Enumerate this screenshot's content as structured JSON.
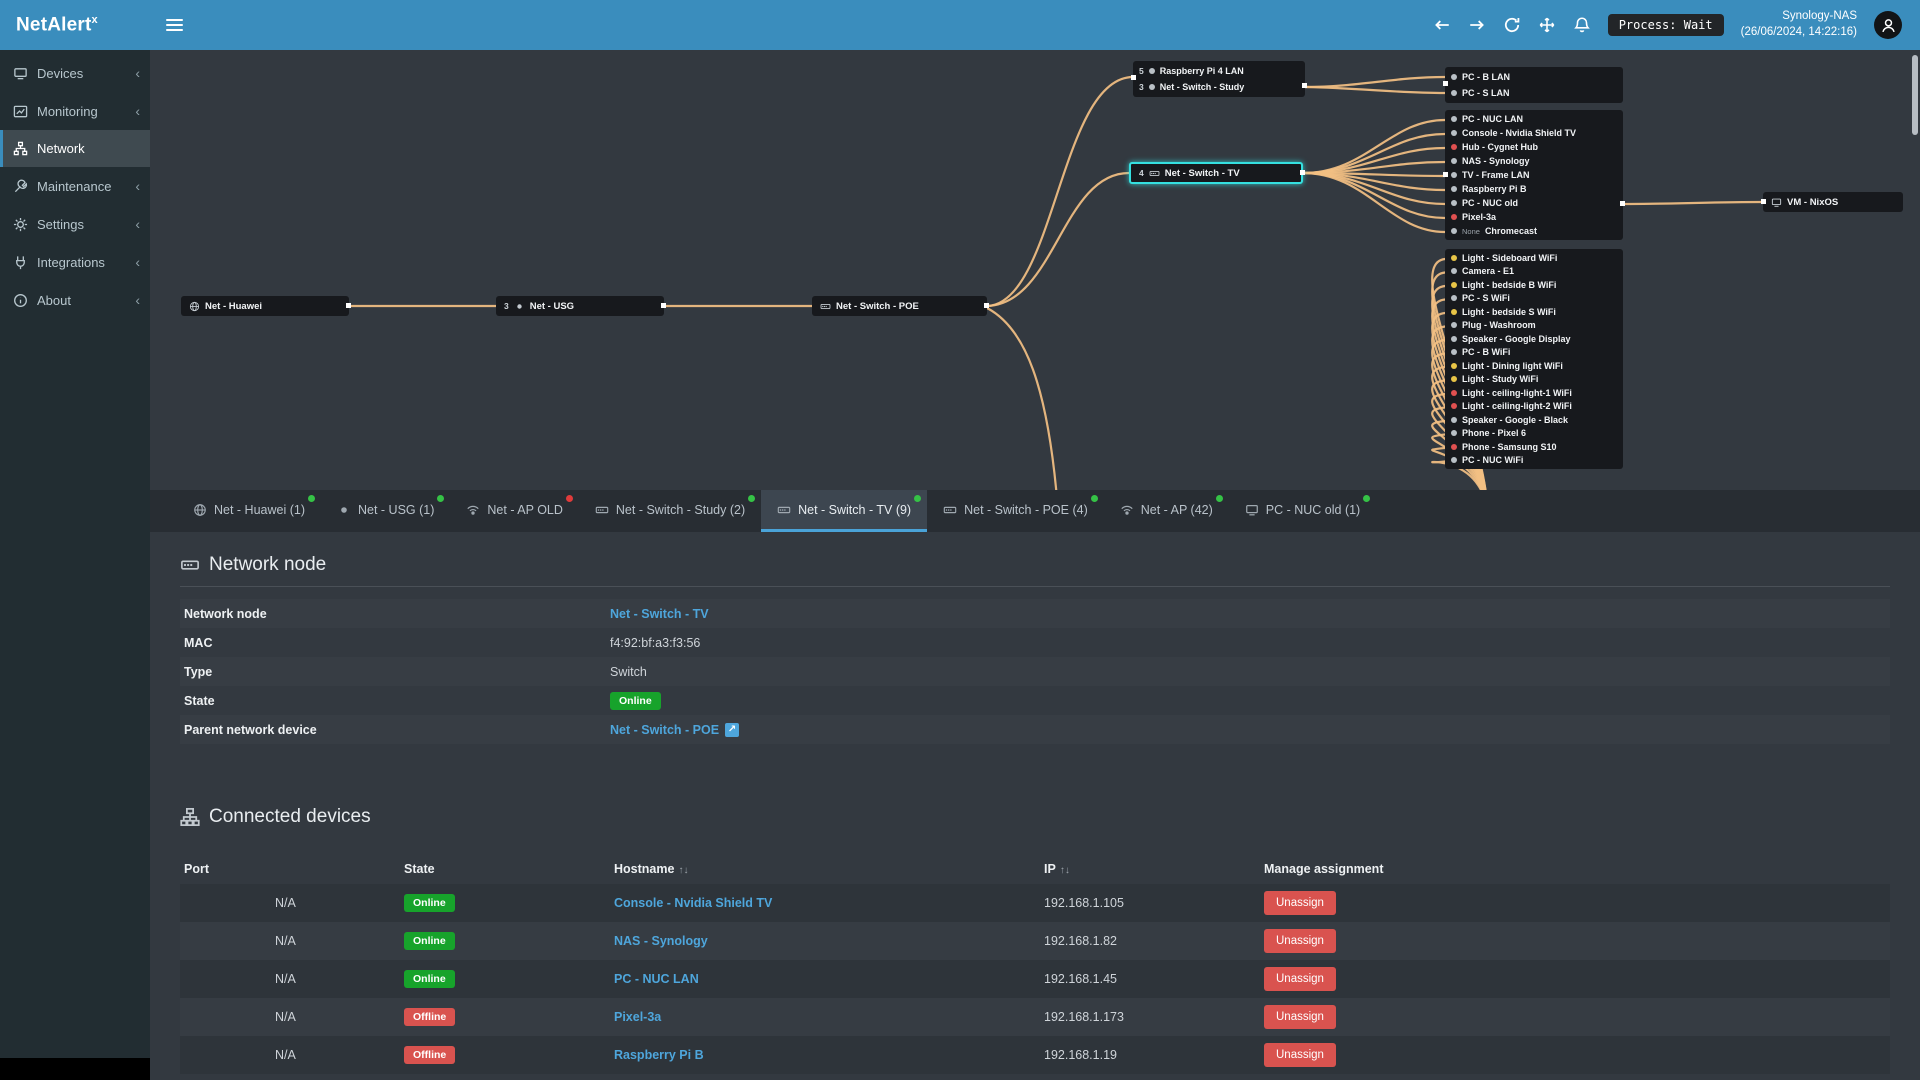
{
  "header": {
    "logo": "NetAlert",
    "logo_sup": "x",
    "process_label": "Process: Wait",
    "host": "Synology-NAS",
    "timestamp": "(26/06/2024, 14:22:16)"
  },
  "icons": {
    "sort": "↑↓",
    "external": "↗",
    "chevron": "‹"
  },
  "sidebar": {
    "items": [
      {
        "label": "Devices",
        "icon": "devices-icon"
      },
      {
        "label": "Monitoring",
        "icon": "monitoring-icon"
      },
      {
        "label": "Network",
        "icon": "network-icon"
      },
      {
        "label": "Maintenance",
        "icon": "maintenance-icon"
      },
      {
        "label": "Settings",
        "icon": "settings-icon"
      },
      {
        "label": "Integrations",
        "icon": "integrations-icon"
      },
      {
        "label": "About",
        "icon": "about-icon"
      }
    ]
  },
  "diagram": {
    "nodes": {
      "huawei": {
        "label": "Net - Huawei",
        "badge": ""
      },
      "usg": {
        "label": "Net - USG",
        "badge": "3"
      },
      "poe": {
        "label": "Net - Switch - POE",
        "badge": ""
      },
      "switch_tv": {
        "label": "Net - Switch - TV",
        "badge": "4"
      },
      "vm_nixos": {
        "label": "VM - NixOS",
        "badge": ""
      }
    },
    "study_group": [
      {
        "label": "Raspberry Pi 4 LAN",
        "badge": "5",
        "color": "#b9c0c6"
      },
      {
        "label": "Net - Switch - Study",
        "badge": "3",
        "color": "#b9c0c6"
      }
    ],
    "lan_group": [
      {
        "label": "PC - B LAN",
        "color": "#b9c0c6"
      },
      {
        "label": "PC - S LAN",
        "color": "#b9c0c6"
      }
    ],
    "tv_group": [
      {
        "label": "PC - NUC LAN",
        "color": "#b9c0c6"
      },
      {
        "label": "Console - Nvidia Shield TV",
        "color": "#b9c0c6"
      },
      {
        "label": "Hub - Cygnet Hub",
        "color": "#e05050"
      },
      {
        "label": "NAS - Synology",
        "color": "#b9c0c6"
      },
      {
        "label": "TV - Frame LAN",
        "color": "#b9c0c6"
      },
      {
        "label": "Raspberry Pi B",
        "color": "#b9c0c6"
      },
      {
        "label": "PC - NUC old",
        "color": "#b9c0c6"
      },
      {
        "label": "Pixel-3a",
        "color": "#e05050"
      },
      {
        "label": "Chromecast",
        "prefix": "None",
        "color": "#b9c0c6"
      }
    ],
    "wifi_group": [
      {
        "label": "Light - Sideboard WiFi",
        "color": "#e8c547"
      },
      {
        "label": "Camera - E1",
        "color": "#b9c0c6"
      },
      {
        "label": "Light - bedside B WiFi",
        "color": "#e8c547"
      },
      {
        "label": "PC - S WiFi",
        "color": "#b9c0c6"
      },
      {
        "label": "Light - bedside S WiFi",
        "color": "#e8c547"
      },
      {
        "label": "Plug - Washroom",
        "color": "#b9c0c6"
      },
      {
        "label": "Speaker - Google Display",
        "color": "#b9c0c6"
      },
      {
        "label": "PC - B WiFi",
        "color": "#b9c0c6"
      },
      {
        "label": "Light - Dining light WiFi",
        "color": "#e8c547"
      },
      {
        "label": "Light - Study WiFi",
        "color": "#e8c547"
      },
      {
        "label": "Light - ceiling-light-1 WiFi",
        "color": "#e05050"
      },
      {
        "label": "Light - ceiling-light-2 WiFi",
        "color": "#e05050"
      },
      {
        "label": "Speaker - Google - Black",
        "color": "#b9c0c6"
      },
      {
        "label": "Phone - Pixel 6",
        "color": "#b9c0c6"
      },
      {
        "label": "Phone - Samsung S10",
        "color": "#e05050"
      },
      {
        "label": "PC - NUC WiFi",
        "color": "#b9c0c6"
      }
    ]
  },
  "tabs": [
    {
      "label": "Net - Huawei (1)",
      "dot": "#35c246"
    },
    {
      "label": "Net - USG (1)",
      "dot": "#35c246"
    },
    {
      "label": "Net - AP OLD",
      "dot": "#e03b3b"
    },
    {
      "label": "Net - Switch - Study (2)",
      "dot": "#35c246"
    },
    {
      "label": "Net - Switch - TV (9)",
      "dot": "#35c246"
    },
    {
      "label": "Net - Switch - POE (4)",
      "dot": "#35c246"
    },
    {
      "label": "Net - AP (42)",
      "dot": "#35c246"
    },
    {
      "label": "PC - NUC old (1)",
      "dot": "#35c246"
    }
  ],
  "node_info": {
    "title": "Network node",
    "fields": [
      {
        "label": "Network node",
        "value": "Net - Switch - TV"
      },
      {
        "label": "MAC",
        "value": "f4:92:bf:a3:f3:56"
      },
      {
        "label": "Type",
        "value": "Switch"
      },
      {
        "label": "State",
        "value": "Online",
        "badge_color": "#17a32b"
      },
      {
        "label": "Parent network device",
        "value": "Net - Switch - POE"
      }
    ]
  },
  "devices": {
    "title": "Connected devices",
    "headers": {
      "port": "Port",
      "state": "State",
      "hostname": "Hostname",
      "ip": "IP",
      "manage": "Manage assignment"
    },
    "rows": [
      {
        "port": "N/A",
        "state": "Online",
        "state_color": "#17a32b",
        "hostname": "Console - Nvidia Shield TV",
        "ip": "192.168.1.105",
        "action": "Unassign"
      },
      {
        "port": "N/A",
        "state": "Online",
        "state_color": "#17a32b",
        "hostname": "NAS - Synology",
        "ip": "192.168.1.82",
        "action": "Unassign"
      },
      {
        "port": "N/A",
        "state": "Online",
        "state_color": "#17a32b",
        "hostname": "PC - NUC LAN",
        "ip": "192.168.1.45",
        "action": "Unassign"
      },
      {
        "port": "N/A",
        "state": "Offline",
        "state_color": "#d9534f",
        "hostname": "Pixel-3a",
        "ip": "192.168.1.173",
        "action": "Unassign"
      },
      {
        "port": "N/A",
        "state": "Offline",
        "state_color": "#d9534f",
        "hostname": "Raspberry Pi B",
        "ip": "192.168.1.19",
        "action": "Unassign"
      }
    ]
  }
}
